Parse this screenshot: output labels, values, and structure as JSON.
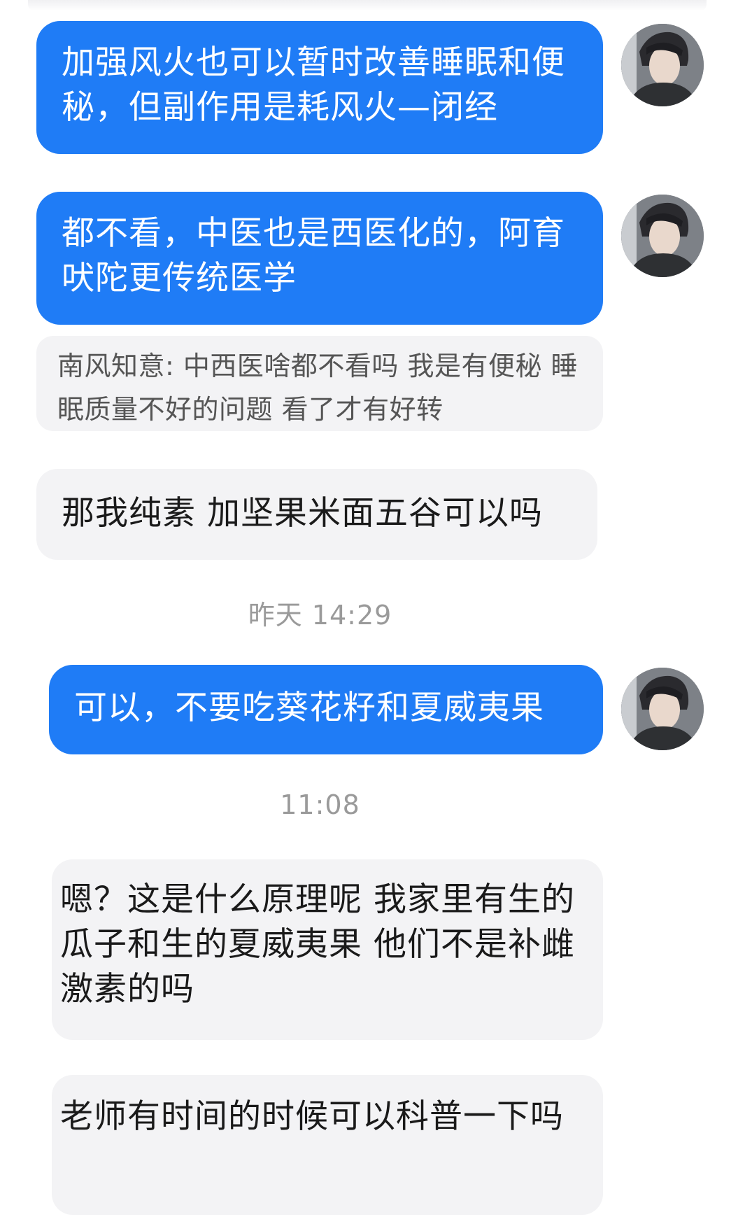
{
  "messages": [
    {
      "side": "me",
      "text": "加强风火也可以暂时改善睡眠和便秘，但副作用是耗风火—闭经"
    },
    {
      "side": "me",
      "text": "都不看，中医也是西医化的，阿育吠陀更传统医学"
    },
    {
      "side": "quote",
      "text": "南风知意: 中西医啥都不看吗 我是有便秘 睡眠质量不好的问题 看了才有好转"
    },
    {
      "side": "them",
      "text": "那我纯素 加坚果米面五谷可以吗"
    },
    {
      "side": "me",
      "text": "可以，不要吃葵花籽和夏威夷果"
    },
    {
      "side": "them",
      "text": "嗯？这是什么原理呢 我家里有生的瓜子和生的夏威夷果 他们不是补雌激素的吗"
    },
    {
      "side": "them",
      "text": "老师有时间的时候可以科普一下吗"
    }
  ],
  "timestamps": [
    "昨天 14:29",
    "11:08"
  ],
  "avatar_icon": "user-avatar-icon",
  "colors": {
    "my_bubble": "#1f7cf6",
    "their_bubble": "#f3f3f5",
    "timestamp": "#9a9a9a"
  }
}
